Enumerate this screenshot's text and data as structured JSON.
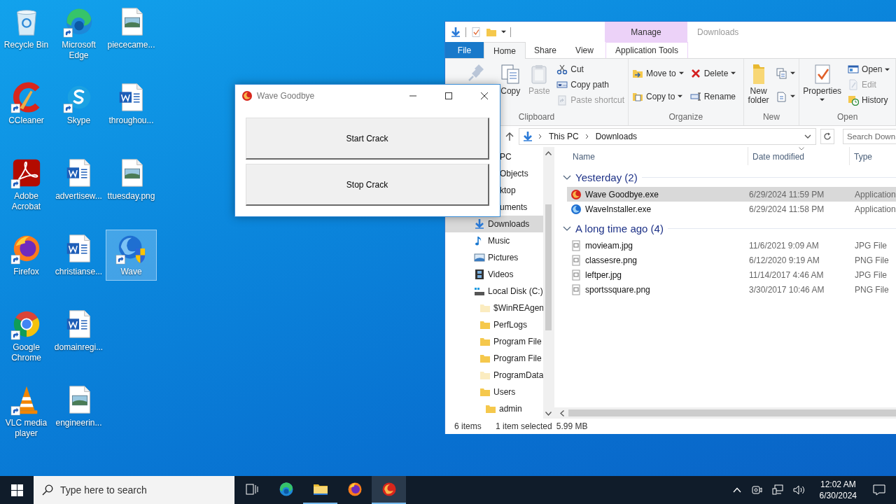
{
  "desktop_icons": [
    {
      "label": "Recycle Bin",
      "shortcut": false,
      "selected": false
    },
    {
      "label": "CCleaner",
      "shortcut": true,
      "selected": false
    },
    {
      "label": "Adobe Acrobat",
      "shortcut": true,
      "selected": false
    },
    {
      "label": "Firefox",
      "shortcut": true,
      "selected": false
    },
    {
      "label": "Google Chrome",
      "shortcut": true,
      "selected": false
    },
    {
      "label": "VLC media player",
      "shortcut": true,
      "selected": false
    },
    {
      "label": "Microsoft Edge",
      "shortcut": true,
      "selected": false
    },
    {
      "label": "Skype",
      "shortcut": true,
      "selected": false
    },
    {
      "label": "advertisew...",
      "shortcut": false,
      "selected": false
    },
    {
      "label": "christianse...",
      "shortcut": false,
      "selected": false
    },
    {
      "label": "domainregi...",
      "shortcut": false,
      "selected": false
    },
    {
      "label": "engineerin...",
      "shortcut": false,
      "selected": false
    },
    {
      "label": "piececame...",
      "shortcut": false,
      "selected": false
    },
    {
      "label": "throughou...",
      "shortcut": false,
      "selected": false
    },
    {
      "label": "ttuesday.png",
      "shortcut": false,
      "selected": false
    },
    {
      "label": "Wave",
      "shortcut": true,
      "selected": true
    }
  ],
  "explorer": {
    "context_group": "Manage",
    "title": "Downloads",
    "tabs": [
      {
        "label": "File",
        "kind": "file",
        "selected": false
      },
      {
        "label": "Home",
        "kind": "tab",
        "selected": true
      },
      {
        "label": "Share",
        "kind": "tab",
        "selected": false
      },
      {
        "label": "View",
        "kind": "tab",
        "selected": false
      },
      {
        "label": "Application Tools",
        "kind": "context",
        "selected": false
      }
    ],
    "ribbon": [
      {
        "label": "Clipboard",
        "items": [
          {
            "kind": "large",
            "disabled": true,
            "dropdown": false
          },
          {
            "kind": "large",
            "label": "Copy",
            "disabled": false,
            "dropdown": false
          },
          {
            "kind": "large",
            "label": "Paste",
            "disabled": true,
            "dropdown": false
          },
          {
            "kind": "stack",
            "commands": [
              {
                "label": "Cut",
                "disabled": false,
                "dropdown": false
              },
              {
                "label": "Copy path",
                "disabled": false,
                "dropdown": false
              },
              {
                "label": "Paste shortcut",
                "disabled": true,
                "dropdown": false
              }
            ]
          }
        ]
      },
      {
        "label": "Organize",
        "items": [
          {
            "kind": "stack",
            "commands": [
              {
                "label": "Move to",
                "disabled": false,
                "dropdown": true
              },
              {
                "label": "Copy to",
                "disabled": false,
                "dropdown": true
              }
            ]
          },
          {
            "kind": "stack",
            "commands": [
              {
                "label": "Delete",
                "disabled": false,
                "dropdown": true
              },
              {
                "label": "Rename",
                "disabled": false,
                "dropdown": false
              }
            ]
          }
        ]
      },
      {
        "label": "New",
        "items": [
          {
            "kind": "large",
            "label": "New folder",
            "disabled": false,
            "dropdown": false
          },
          {
            "kind": "stack",
            "commands": [
              {
                "disabled": false,
                "dropdown": true
              },
              {
                "disabled": false,
                "dropdown": true
              }
            ]
          }
        ]
      },
      {
        "label": "Open",
        "items": [
          {
            "kind": "large",
            "label": "Properties",
            "disabled": false,
            "dropdown": true
          },
          {
            "kind": "stack",
            "commands": [
              {
                "label": "Open",
                "disabled": false,
                "dropdown": true
              },
              {
                "label": "Edit",
                "disabled": true,
                "dropdown": false
              },
              {
                "label": "History",
                "disabled": false,
                "dropdown": false
              }
            ]
          }
        ]
      }
    ],
    "path": [
      "This PC",
      "Downloads"
    ],
    "search_placeholder": "Search Down",
    "nav": [
      {
        "label": "PC",
        "kind": "covered",
        "selected": false,
        "children": [
          {
            "label": "Objects",
            "kind": "covered",
            "selected": false
          },
          {
            "label": "ktop",
            "kind": "covered",
            "selected": false
          },
          {
            "label": "uments",
            "kind": "covered",
            "selected": false
          },
          {
            "label": "Downloads",
            "kind": "downloads",
            "selected": true
          },
          {
            "label": "Music",
            "kind": "music",
            "selected": false
          },
          {
            "label": "Pictures",
            "kind": "pictures",
            "selected": false
          },
          {
            "label": "Videos",
            "kind": "videos",
            "selected": false
          },
          {
            "label": "Local Disk (C:)",
            "kind": "drive",
            "selected": false,
            "children": [
              {
                "label": "$WinREAgen",
                "kind": "hidden",
                "selected": false
              },
              {
                "label": "PerfLogs",
                "kind": "folder",
                "selected": false
              },
              {
                "label": "Program File",
                "kind": "folder",
                "selected": false
              },
              {
                "label": "Program File",
                "kind": "folder",
                "selected": false
              },
              {
                "label": "ProgramData",
                "kind": "hidden",
                "selected": false
              },
              {
                "label": "Users",
                "kind": "folder",
                "selected": false,
                "children": [
                  {
                    "label": "admin",
                    "kind": "folder",
                    "selected": false
                  }
                ]
              }
            ]
          }
        ]
      }
    ],
    "columns": [
      {
        "label": "Name",
        "sorted": false
      },
      {
        "label": "Date modified",
        "sorted": true
      },
      {
        "label": "Type",
        "sorted": false
      }
    ],
    "groups": [
      {
        "label": "Yesterday (2)",
        "expanded": true,
        "files": [
          {
            "name": "Wave Goodbye.exe",
            "kind": "goodbye",
            "date_modified": "6/29/2024 11:59 PM",
            "type": "Application",
            "selected": true
          },
          {
            "name": "WaveInstaller.exe",
            "kind": "installer",
            "date_modified": "6/29/2024 11:58 PM",
            "type": "Application",
            "selected": false
          }
        ]
      },
      {
        "label": "A long time ago (4)",
        "expanded": true,
        "files": [
          {
            "name": "movieam.jpg",
            "kind": "image",
            "date_modified": "11/6/2021 9:09 AM",
            "type": "JPG File",
            "selected": false
          },
          {
            "name": "classesre.png",
            "kind": "image",
            "date_modified": "6/12/2020 9:19 AM",
            "type": "PNG File",
            "selected": false
          },
          {
            "name": "leftper.jpg",
            "kind": "image",
            "date_modified": "11/14/2017 4:46 AM",
            "type": "JPG File",
            "selected": false
          },
          {
            "name": "sportssquare.png",
            "kind": "image",
            "date_modified": "3/30/2017 10:46 AM",
            "type": "PNG File",
            "selected": false
          }
        ]
      }
    ],
    "status": {
      "count": "6 items",
      "selection": "1 item selected",
      "size": "5.99 MB"
    }
  },
  "dialog": {
    "title": "Wave Goodbye",
    "buttons": [
      "Start Crack",
      "Stop Crack"
    ]
  },
  "taskbar": {
    "search_placeholder": "Type here to search",
    "apps": [
      {
        "running": false,
        "selected": false
      },
      {
        "running": true,
        "selected": false
      },
      {
        "running": false,
        "selected": false
      },
      {
        "running": true,
        "selected": true
      }
    ],
    "time": "12:02 AM",
    "date": "6/30/2024"
  }
}
